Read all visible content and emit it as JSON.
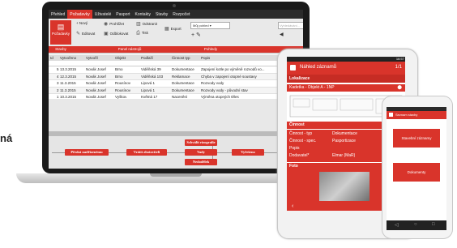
{
  "cut_text": "ná",
  "laptop": {
    "menu": [
      "Přehled",
      "Požadavky",
      "Uživatelé",
      "Pasport",
      "Kontakty",
      "Stavby",
      "Rozpočet"
    ],
    "active_menu_index": 1,
    "ribbon": {
      "big_button": "Požadavky",
      "nový": "+ Nový",
      "prohlížet": "Prohlížet",
      "odstranit": "Odstranit",
      "editovat": "Editovat",
      "odblokovat": "Odblokovat",
      "tisk": "Tisk",
      "export": "Export",
      "view_select": "Můj pohled",
      "search_placeholder": "Vyhledávání...",
      "footer": [
        "Stavby",
        "Panel nástrojů",
        "Pohledy"
      ]
    },
    "grid": {
      "headers": [
        "Id",
        "Vytvořeno",
        "Vytvořil",
        "Objekt",
        "Podlaží",
        "Činnost typ",
        "Popis"
      ],
      "rows": [
        [
          "5",
          "13.3.2015",
          "Novák Josef",
          "Brno",
          "Viděňská 39",
          "Dokumentace",
          "Zapojení kotle po výměně rozvodů vo..."
        ],
        [
          "4",
          "12.3.2015",
          "Novák Josef",
          "Brno",
          "Viděňská 103",
          "Reklamace",
          "Chyba v zapojení otopné soustavy"
        ],
        [
          "3",
          "11.3.2015",
          "Novák Josef",
          "Rousínov",
          "Lipová 1",
          "Dokumentace",
          "Rozvody vody"
        ],
        [
          "2",
          "11.3.2015",
          "Novák Josef",
          "Rousínov",
          "Lipová 1",
          "Dokumentace",
          "Rozvody vody - původní stav"
        ],
        [
          "1",
          "10.3.2015",
          "Novák Josef",
          "Vyškov",
          "Květná 17",
          "Nacenění",
          "Výměna otopných těles"
        ]
      ]
    },
    "workflow": {
      "boxes": [
        "Předat nadřízenému",
        "Vrátit zhotoviteli",
        "Schválit rizografie",
        "Vady",
        "Nedodělek",
        "Vyřešeno"
      ]
    }
  },
  "tablet": {
    "status_time": "16:57",
    "title": "Náhled záznamů",
    "page": "1/1",
    "sections": {
      "lokalizace": "Lokalizace",
      "lokalizace_value": "Kadetka - Objekt A - 1NP",
      "cinnost": "Činnost",
      "foto": "Foto"
    },
    "cinnost_rows": [
      {
        "label": "Činnost - typ",
        "value": "Dokumentace"
      },
      {
        "label": "Činnost - spec.",
        "value": "Pasportizace"
      },
      {
        "label": "Popis",
        "value": ""
      },
      {
        "label": "Dodavatel*",
        "value": "Elmar (MaR)"
      }
    ]
  },
  "phone": {
    "title": "Seznam stavby",
    "buttons": [
      "Stavební záznamy",
      "Dokumenty"
    ]
  }
}
